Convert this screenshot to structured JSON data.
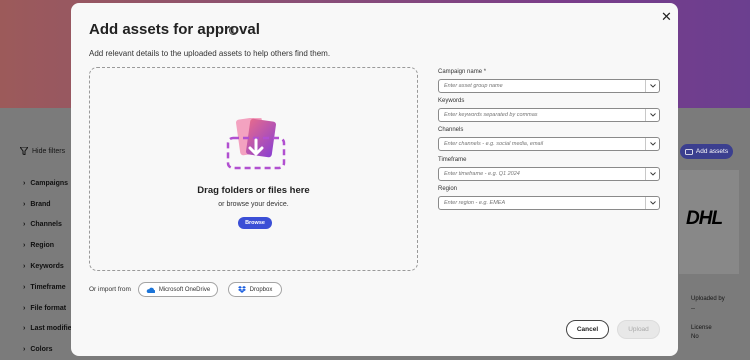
{
  "background": {
    "hide_filters": "Hide filters",
    "filters": [
      "Campaigns",
      "Brand",
      "Channels",
      "Region",
      "Keywords",
      "Timeframe",
      "File format",
      "Last modified",
      "Colors"
    ],
    "add_assets": "Add assets",
    "card_logo": "DHL",
    "uploaded_by_label": "Uploaded by",
    "uploaded_by_value": "--",
    "license_label": "License",
    "license_value": "No"
  },
  "modal": {
    "title": "Add assets for approval",
    "subtitle": "Add relevant details to the uploaded assets to help others find them.",
    "drop_title": "Drag folders or files here",
    "drop_sub": "or browse your device.",
    "browse": "Browse",
    "import_label": "Or import from",
    "onedrive": "Microsoft OneDrive",
    "dropbox": "Dropbox",
    "fields": {
      "campaign": {
        "label": "Campaign name",
        "required_mark": "*",
        "placeholder": "Enter asset group name"
      },
      "keywords": {
        "label": "Keywords",
        "placeholder": "Enter keywords separated by commas"
      },
      "channels": {
        "label": "Channels",
        "placeholder": "Enter channels - e.g. social media, email"
      },
      "timeframe": {
        "label": "Timeframe",
        "placeholder": "Enter timeframe - e.g. Q1 2024"
      },
      "region": {
        "label": "Region",
        "placeholder": "Enter region - e.g. EMEA"
      }
    },
    "cancel": "Cancel",
    "upload": "Upload"
  },
  "colors": {
    "accent": "#3b4fd6",
    "banner": "#8a4f76"
  },
  "icons": [
    "close-icon",
    "info-icon",
    "upload-icon",
    "onedrive-icon",
    "dropbox-icon",
    "chevron-down-icon",
    "filter-icon",
    "chevron-right-icon"
  ]
}
